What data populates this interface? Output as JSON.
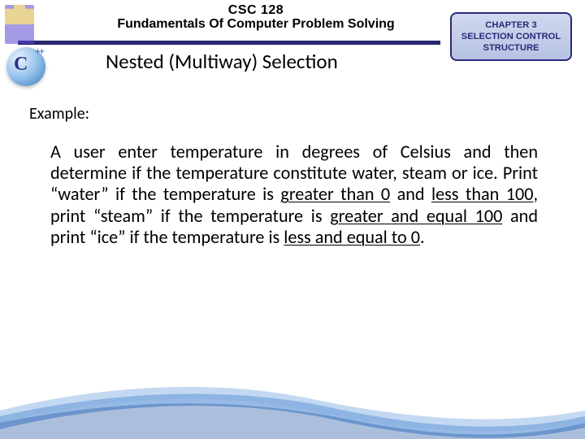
{
  "header": {
    "course_code": "CSC 128",
    "course_title": "Fundamentals Of Computer Problem Solving"
  },
  "chapter": {
    "line1": "CHAPTER 3",
    "line2": "SELECTION CONTROL",
    "line3": "STRUCTURE"
  },
  "section_title": "Nested (Multiway) Selection",
  "example_label": "Example:",
  "body": {
    "p1a": "A user enter temperature in degrees of Celsius and then determine if the temperature constitute water, steam or ice. Print “water” if the temperature is ",
    "u1": "greater than 0",
    "p1b": " and ",
    "u2": "less than 100",
    "p1c": ", print “steam” if the temperature is ",
    "u3": "greater and equal 100",
    "p1d": " and print “ice” if the temperature is ",
    "u4": "less and equal to 0",
    "p1e": "."
  },
  "icons": {
    "cpp_label": "C",
    "cpp_plus": "++"
  }
}
